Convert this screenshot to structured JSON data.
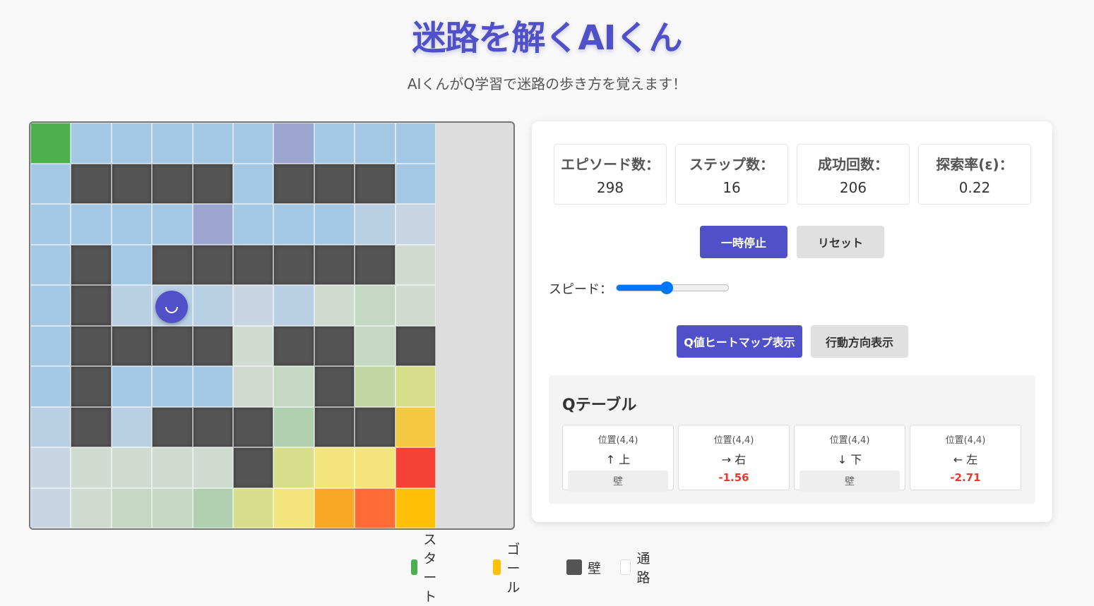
{
  "header": {
    "title": "迷路を解くAIくん",
    "subtitle": "AIくんがQ学習で迷路の歩き方を覚えます！"
  },
  "colors": {
    "accent": "#5050c8",
    "start": "#4caf50",
    "goal": "#ffc107",
    "wall": "#555555",
    "path": "#ffffff",
    "negative_value": "#e53935"
  },
  "maze": {
    "rows": [
      [
        "#4caf50",
        "#a5c8e4",
        "#a5c8e4",
        "#a5c8e4",
        "#a5c8e4",
        "#a5c8e4",
        "#9ca6cf",
        "#a5c8e4",
        "#a5c8e4",
        "#a5c8e4"
      ],
      [
        "#a5c8e4",
        "wall",
        "wall",
        "wall",
        "wall",
        "#a5c8e4",
        "wall",
        "wall",
        "wall",
        "#a5c8e4"
      ],
      [
        "#a5c8e4",
        "#a5c8e4",
        "#a5c8e4",
        "#a5c8e4",
        "#9ca6cf",
        "#a5c8e4",
        "#a5c8e4",
        "#a5c8e4",
        "#b9cfe3",
        "#c8d6e3"
      ],
      [
        "#a5c8e4",
        "wall",
        "#a5c8e4",
        "wall",
        "wall",
        "wall",
        "wall",
        "wall",
        "wall",
        "#cfdad0"
      ],
      [
        "#a5c8e4",
        "wall",
        "#b9cfe3",
        "#b9cfe3",
        "#b9cfe3",
        "#c8d6e3",
        "#b9cfe3",
        "#cfdad0",
        "#c4d8c4",
        "#cfdad0"
      ],
      [
        "#a5c8e4",
        "wall",
        "wall",
        "wall",
        "wall",
        "#cfdad0",
        "wall",
        "wall",
        "#c4d8c4",
        "wall"
      ],
      [
        "#a5c8e4",
        "wall",
        "#a5c8e4",
        "#a5c8e4",
        "#a5c8e4",
        "#cfdad0",
        "#c4d8c4",
        "wall",
        "#c2d6a4",
        "#d8df8b"
      ],
      [
        "#b9cfe3",
        "wall",
        "#b9cfe3",
        "wall",
        "wall",
        "wall",
        "#b0d0b0",
        "wall",
        "wall",
        "#f5c842"
      ],
      [
        "#c8d6e3",
        "#cfdad0",
        "#cfdad0",
        "#cfdad0",
        "#cfdad0",
        "wall",
        "#d8df8b",
        "#f3e47c",
        "#f3e47c",
        "#f44336"
      ],
      [
        "#c8d6e3",
        "#cfdad0",
        "#c4d8c4",
        "#c4d8c4",
        "#b0d0b0",
        "#d8df8b",
        "#f3e47c",
        "#f9a825",
        "#ff6b35",
        "#ffc107"
      ]
    ],
    "agent_face": "smile"
  },
  "stats": {
    "episodes_label": "エピソード数：",
    "episodes_value": "298",
    "steps_label": "ステップ数：",
    "steps_value": "16",
    "success_label": "成功回数：",
    "success_value": "206",
    "epsilon_label": "探索率(ε)：",
    "epsilon_value": "0.22"
  },
  "controls": {
    "pause_label": "一時停止",
    "reset_label": "リセット",
    "speed_label": "スピード：",
    "speed_fraction": 0.45,
    "heatmap_label": "Q値ヒートマップ表示",
    "direction_label": "行動方向表示"
  },
  "qtable": {
    "title": "Qテーブル",
    "cards": [
      {
        "pos": "位置(4,4)",
        "action": "↑ 上",
        "value": "壁",
        "is_wall": true
      },
      {
        "pos": "位置(4,4)",
        "action": "→ 右",
        "value": "-1.56",
        "is_wall": false
      },
      {
        "pos": "位置(4,4)",
        "action": "↓ 下",
        "value": "壁",
        "is_wall": true
      },
      {
        "pos": "位置(4,4)",
        "action": "← 左",
        "value": "-2.71",
        "is_wall": false
      }
    ]
  },
  "legend": {
    "start_label": "スタート",
    "goal_label": "ゴール",
    "wall_label": "壁",
    "path_label": "通路"
  }
}
